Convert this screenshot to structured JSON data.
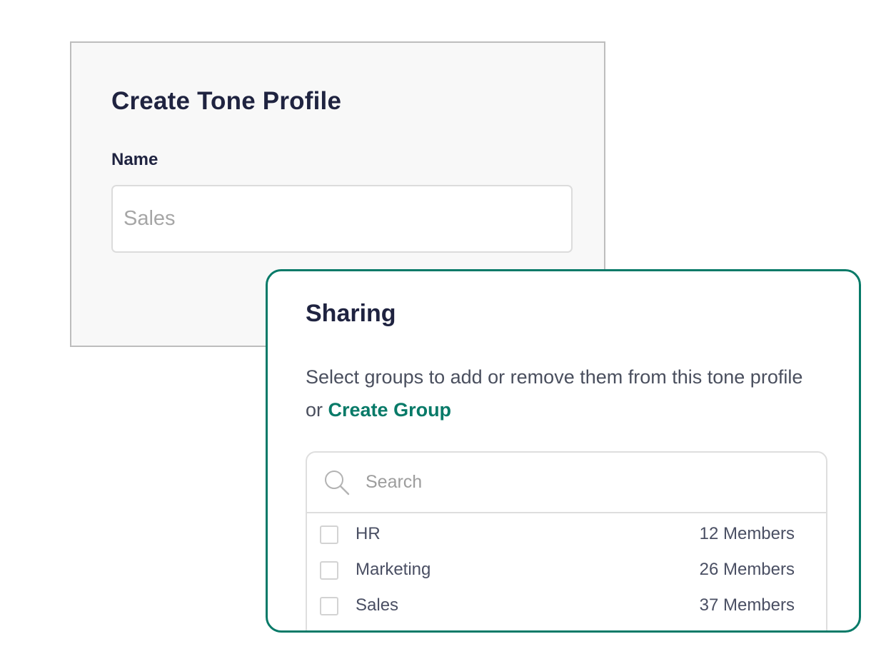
{
  "tone_profile": {
    "title": "Create Tone Profile",
    "name_label": "Name",
    "name_placeholder": "Sales",
    "name_value": ""
  },
  "sharing": {
    "title": "Sharing",
    "description": "Select groups to add or remove them from this tone profile or ",
    "create_group_link": "Create Group",
    "search_placeholder": "Search",
    "search_icon": "search-icon",
    "groups": [
      {
        "name": "HR",
        "members": "12 Members",
        "checked": false
      },
      {
        "name": "Marketing",
        "members": "26 Members",
        "checked": false
      },
      {
        "name": "Sales",
        "members": "37 Members",
        "checked": false
      }
    ]
  },
  "colors": {
    "accent": "#077a68",
    "heading": "#1f2340",
    "body_text": "#4a4f5e",
    "card_background": "#f8f8f8"
  }
}
